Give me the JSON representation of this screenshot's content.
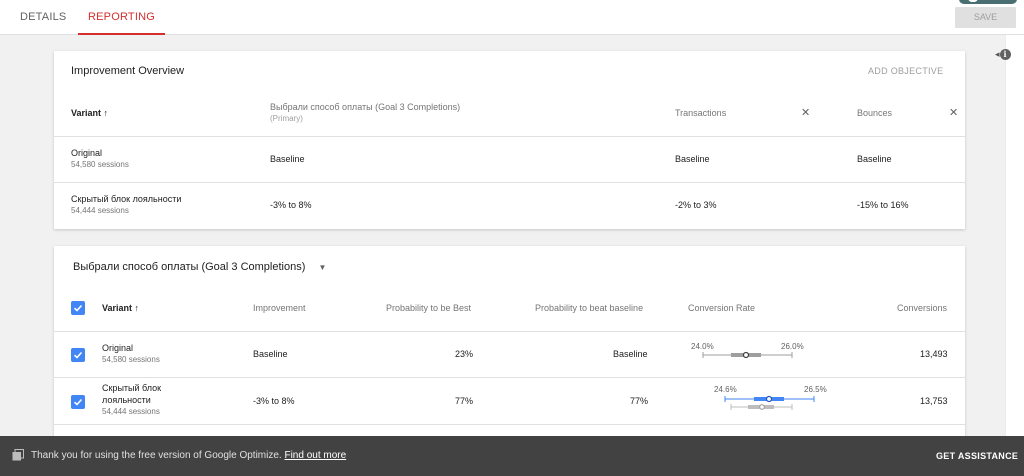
{
  "tabs": [
    {
      "label": "DETAILS"
    },
    {
      "label": "REPORTING",
      "active": true
    }
  ],
  "save_label": "SAVE",
  "overview": {
    "title": "Improvement Overview",
    "add_objective": "ADD OBJECTIVE",
    "headers": {
      "variant": "Variant",
      "goal": "Выбрали способ оплаты (Goal 3 Completions)",
      "goal_sub": "(Primary)",
      "transactions": "Transactions",
      "bounces": "Bounces"
    },
    "rows": [
      {
        "name": "Original",
        "sessions": "54,580 sessions",
        "goal": "Baseline",
        "transactions": "Baseline",
        "bounces": "Baseline"
      },
      {
        "name": "Скрытый блок лояльности",
        "sessions": "54,444 sessions",
        "goal": "-3% to 8%",
        "transactions": "-2% to 3%",
        "bounces": "-15% to 16%"
      }
    ]
  },
  "objective": {
    "title": "Выбрали способ оплаты (Goal 3 Completions)",
    "headers": {
      "variant": "Variant",
      "improvement": "Improvement",
      "prob_best": "Probability to be Best",
      "prob_beat": "Probability to beat baseline",
      "conv_rate": "Conversion Rate",
      "conversions": "Conversions"
    },
    "rows": [
      {
        "name": "Original",
        "sessions": "54,580 sessions",
        "improvement": "Baseline",
        "prob_best": "23%",
        "prob_beat": "Baseline",
        "range_low": "24.0%",
        "range_high": "26.0%",
        "conversions": "13,493"
      },
      {
        "name_line1": "Скрытый блок",
        "name_line2": "лояльности",
        "sessions": "54,444 sessions",
        "improvement": "-3% to 8%",
        "prob_best": "77%",
        "prob_beat": "77%",
        "range_low": "24.6%",
        "range_high": "26.5%",
        "conversions": "13,753"
      }
    ]
  },
  "banner": {
    "text": "Thank you for using the free version of Google Optimize.",
    "link": "Find out more",
    "assist": "GET ASSISTANCE"
  },
  "colors": {
    "accent_red": "#d32f2f",
    "checkbox_blue": "#4285f4",
    "banner_bg": "#424242"
  },
  "icons": [
    "sort-up-arrow-icon",
    "close-icon",
    "dropdown-arrow-icon",
    "info-icon",
    "checkbox-checked-icon",
    "feedback-icon"
  ]
}
